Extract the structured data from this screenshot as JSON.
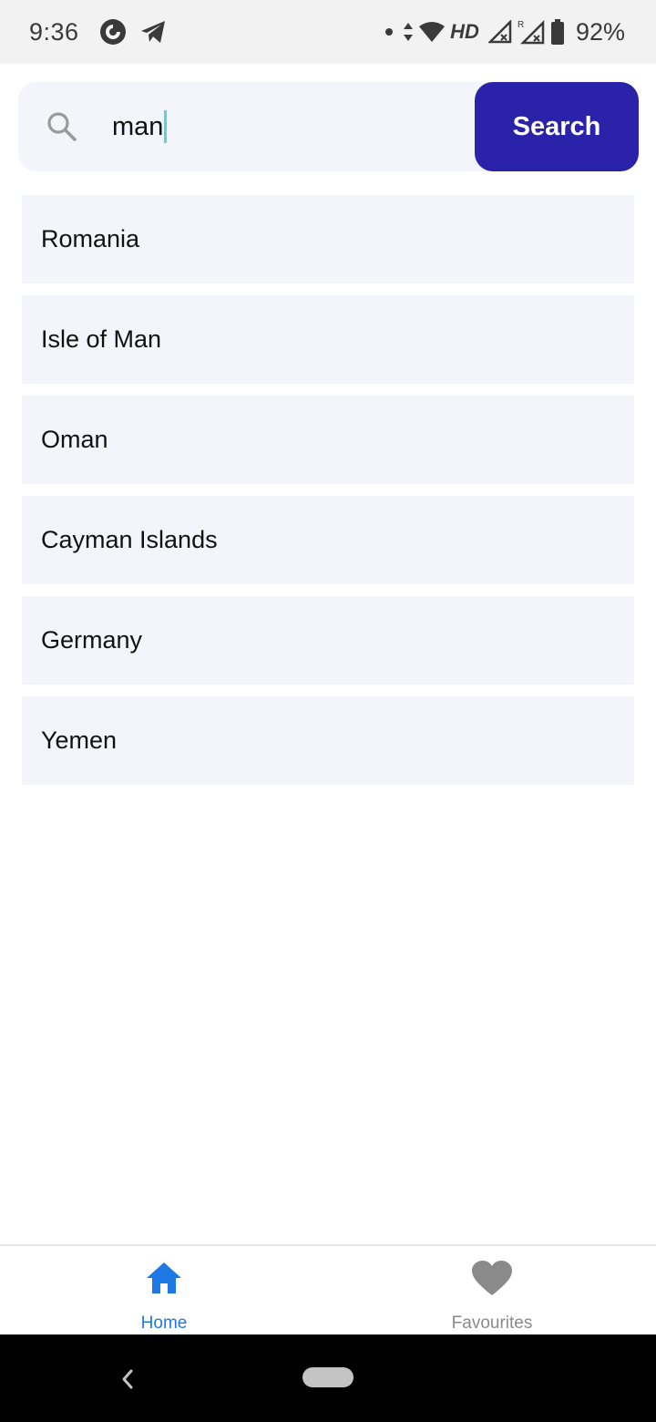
{
  "status_bar": {
    "time": "9:36",
    "network_label": "HD",
    "battery": "92%",
    "icons": [
      "pocket-casts-icon",
      "telegram-icon",
      "dot-icon",
      "data-arrows-icon",
      "wifi-icon",
      "signal-icon",
      "signal-roaming-icon",
      "battery-icon"
    ]
  },
  "search": {
    "value": "man",
    "button_label": "Search",
    "icon": "search-icon"
  },
  "results": [
    {
      "label": "Romania"
    },
    {
      "label": "Isle of Man"
    },
    {
      "label": "Oman"
    },
    {
      "label": "Cayman Islands"
    },
    {
      "label": "Germany"
    },
    {
      "label": "Yemen"
    }
  ],
  "tabs": [
    {
      "label": "Home",
      "icon": "home-icon",
      "active": true
    },
    {
      "label": "Favourites",
      "icon": "heart-icon",
      "active": false
    }
  ],
  "colors": {
    "accent": "#2a22a8",
    "active_tab": "#1e78e6",
    "inactive_tab": "#8a8a8a",
    "row_background": "#f4f5fa"
  }
}
